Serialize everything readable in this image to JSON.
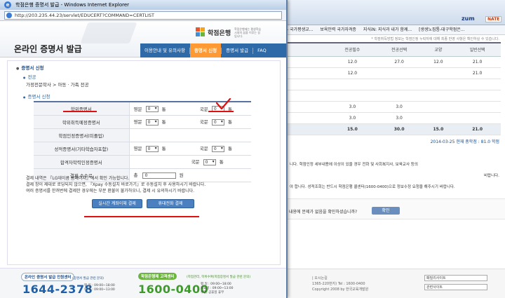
{
  "popup": {
    "window_title": "학점은행 증명서 발급 - Windows Internet Explorer",
    "url": "http://203.235.44.23/servlet/EDUCERT?COMMAND=CERTLIST",
    "bank_name": "학점은행",
    "bank_tagline": "학점은행제는 평생학습 시대의 꿈을 이루는 길입니다.",
    "page_title": "온라인 증명서 발급",
    "nav": [
      "이용안내 및 유의사항",
      "증명서 신청",
      "증명서 발급",
      "FAQ"
    ],
    "active_tab": "증명서 신청",
    "section_title": "증명서 신청",
    "sub_major": "전공",
    "major_path": "가정전문학사 > 아동 · 가족 전공",
    "sub_certs": "증명서 신청",
    "certs": [
      {
        "name": "학위증명서",
        "lang1": "영문",
        "val1": "0",
        "unit1": "통",
        "lang2": "국문",
        "val2": "0",
        "unit2": "통"
      },
      {
        "name": "학위취득예정증명서",
        "lang1": "영문",
        "val1": "0",
        "unit1": "통",
        "lang2": "국문",
        "val2": "0",
        "unit2": "통"
      },
      {
        "name": "학점인정증명서(미졸업)",
        "lang1": "",
        "val1": "",
        "unit1": "",
        "lang2": "",
        "val2": "",
        "unit2": ""
      },
      {
        "name": "성적증명서(기타학습자포함)",
        "lang1": "영문",
        "val1": "0",
        "unit1": "통",
        "lang2": "국문",
        "val2": "0",
        "unit2": "통"
      },
      {
        "name": "합격자학력인정증명서",
        "lang1": "",
        "val1": "",
        "unit1": "",
        "lang2": "국문",
        "val2": "0",
        "unit2": "통"
      }
    ],
    "fee_label": "결제 수수료",
    "fee_prefix": "총",
    "fee_value": "0",
    "fee_unit": "원",
    "notes": [
      "결제 내역은 『LG데이콤 홈페이지』에서 확인 가능합니다.",
      "결제 창이 제대로 로딩되지 않으면, 『Xpay 수동설치 바로가기』로 수동설치 후 사용하시기 바랍니다.",
      "여러 증명서를 한꺼번에 결제한 경우에는 부분 환불이 불가하오니, 결제 시 유의하시기 바랍니다."
    ],
    "btn_realtime": "실시간 계좌이체 결제",
    "btn_mobile": "휴대전화 결제",
    "footer": {
      "left_label": "온라인 증명서 발급 민원센터",
      "left_sub": "(증명서 발급 관련 문의)",
      "left_phone": "1644-2378",
      "left_hours": [
        "평   일 : 09:00~18:00",
        "토   요 : 09:00~13:00"
      ],
      "right_label": "학점은행제 고객센터",
      "right_sub": "(학점관리, 학위수여(학점증명서 발급 관련 문의)",
      "right_phone": "1600-0400",
      "right_hours": [
        "평   일 : 09:00~18:00",
        "토요일 : 09:00~13:00",
        "주말, 공휴일 휴무"
      ]
    },
    "colors": {
      "nav_bg": "#2e6aa8",
      "active_tab": "#ff9933",
      "annotation": "#e01010"
    }
  },
  "background": {
    "brand": "zum",
    "nate": "NATE",
    "favorites": [
      "- 국가평생교...",
      "보육인력 국가자격증",
      "지식iN: 지식과 내가 함께...",
      "[생생노집통-대구학점은..."
    ],
    "note": "* 학점취득방법 정보는 학점인정 누락자에 대해 최종 반영 사항은 확인하실 수 있습니다.",
    "columns": [
      "전공필수",
      "전공선택",
      "교양",
      "일반선택"
    ],
    "rows": [
      [
        "12.0",
        "27.0",
        "12.0",
        "21.0"
      ],
      [
        "12.0",
        "",
        "",
        "21.0"
      ],
      [
        "",
        "",
        "",
        ""
      ],
      [
        "",
        "",
        "",
        ""
      ],
      [
        "3.0",
        "3.0",
        "",
        ""
      ],
      [
        "3.0",
        "3.0",
        "",
        ""
      ]
    ],
    "total": [
      "15.0",
      "30.0",
      "15.0",
      "21.0"
    ],
    "summary": "2014-03-25 현재 총학점 : 81.0 학점",
    "para1": "니다. 학점인정 세부내용에 이상이 있을 경우 전화 및 사회복지사, 보육교사 등의",
    "para1b": "비랍니다.",
    "para2": "야 합니다. 성적조회는 반드시 학점은행 콜센터(1600-0400)으로 정보수정 요청을 해주시기 바랍니다.",
    "confirm_text": "내용에 문제가 없음을 확인하셨습니까?",
    "ok_label": "확인",
    "footer_text": [
      "|  오시는길",
      "1365-220번지)  Tel : 1600-0400",
      "Copyright 2008 by 한국교육개발원"
    ],
    "selects": [
      "패밀리사이트",
      "관련사이트"
    ]
  }
}
